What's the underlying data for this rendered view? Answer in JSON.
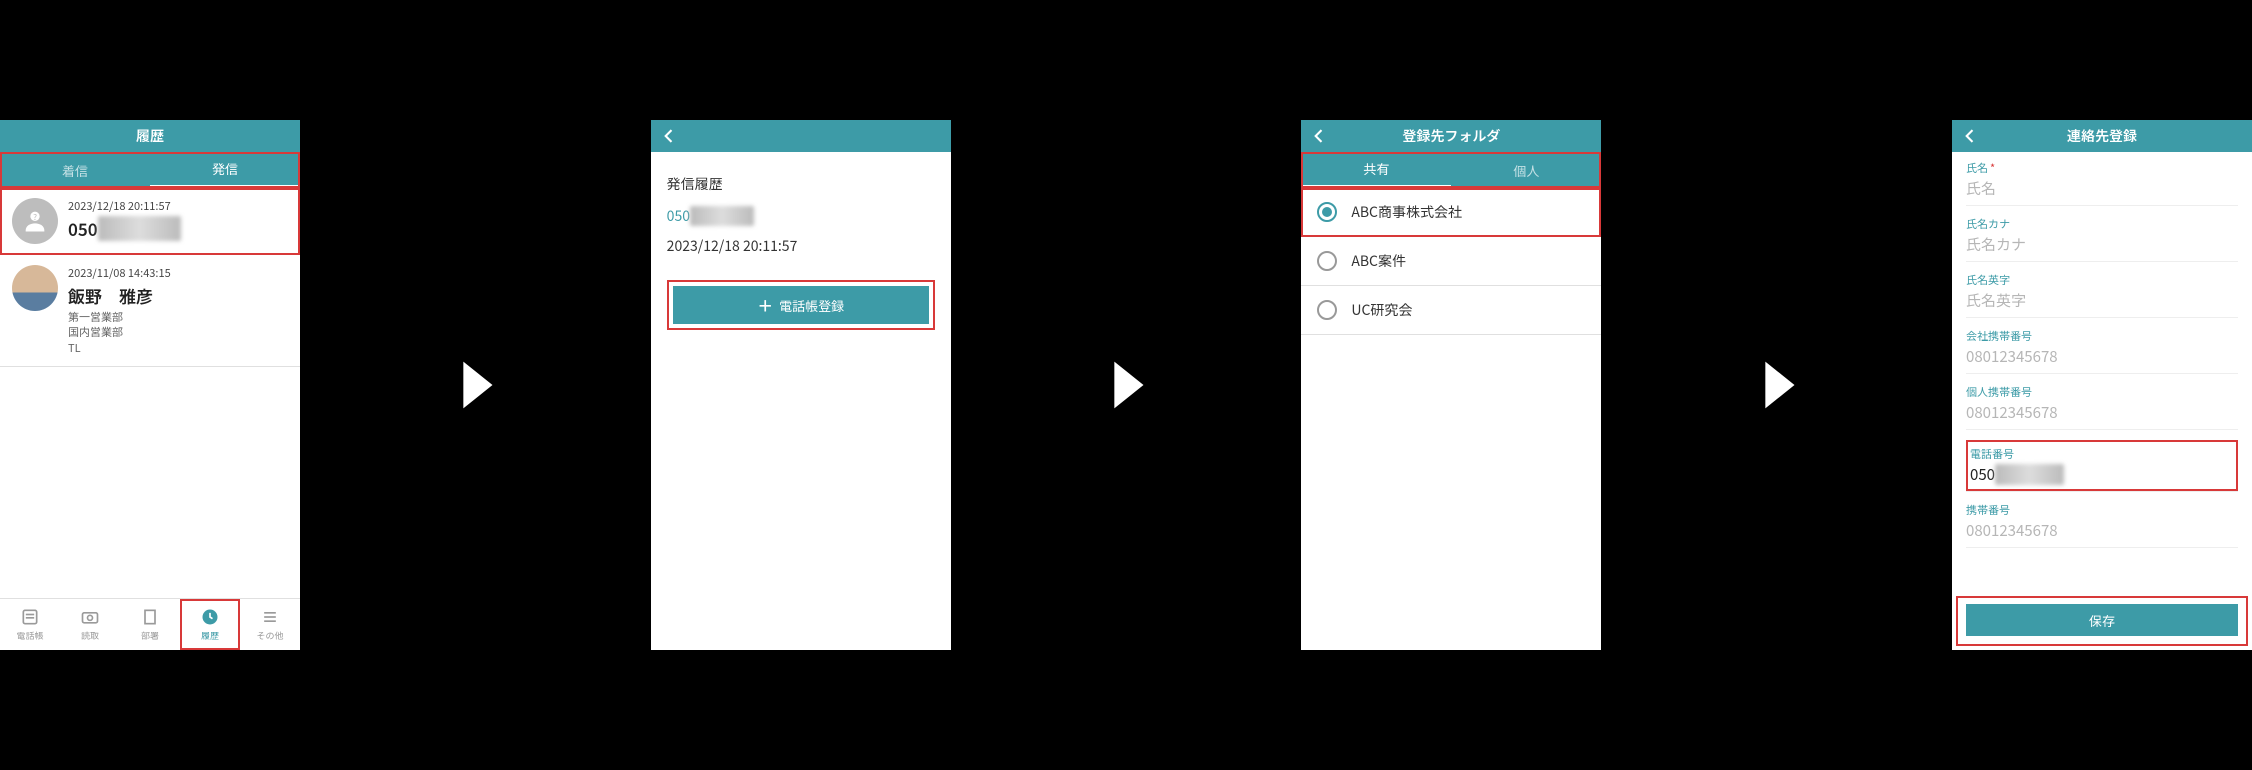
{
  "screen1": {
    "title": "履歴",
    "tabs": {
      "incoming": "着信",
      "outgoing": "発信"
    },
    "entries": [
      {
        "timestamp": "2023/12/18 20:11:57",
        "main_prefix": "050",
        "main_hidden": "XXXXXXXX",
        "sub": ""
      },
      {
        "timestamp": "2023/11/08 14:43:15",
        "main": "飯野　雅彦",
        "sub_line1": "第一営業部",
        "sub_line2": "国内営業部",
        "sub_line3": "TL"
      }
    ],
    "bottomnav": {
      "phonebook": "電話帳",
      "scan": "読取",
      "dept": "部署",
      "history": "履歴",
      "other": "その他"
    }
  },
  "screen2": {
    "section_title": "発信履歴",
    "number_prefix": "050",
    "number_hidden": "XXXXXXXX",
    "datetime": "2023/12/18 20:11:57",
    "register_btn": "電話帳登録"
  },
  "screen3": {
    "title": "登録先フォルダ",
    "tabs": {
      "shared": "共有",
      "personal": "個人"
    },
    "folders": {
      "f1": "ABC商事株式会社",
      "f2": "ABC案件",
      "f3": "UC研究会"
    }
  },
  "screen4": {
    "title": "連絡先登録",
    "fields": {
      "name": {
        "label": "氏名",
        "placeholder": "氏名",
        "required": true
      },
      "kana": {
        "label": "氏名カナ",
        "placeholder": "氏名カナ"
      },
      "eiji": {
        "label": "氏名英字",
        "placeholder": "氏名英字"
      },
      "corp_mobile": {
        "label": "会社携帯番号",
        "placeholder": "08012345678"
      },
      "pers_mobile": {
        "label": "個人携帯番号",
        "placeholder": "08012345678"
      },
      "tel": {
        "label": "電話番号",
        "value_prefix": "050",
        "value_hidden": "XXXXXXXX"
      },
      "mobile": {
        "label": "携帯番号",
        "placeholder": "08012345678"
      }
    },
    "save_btn": "保存"
  }
}
